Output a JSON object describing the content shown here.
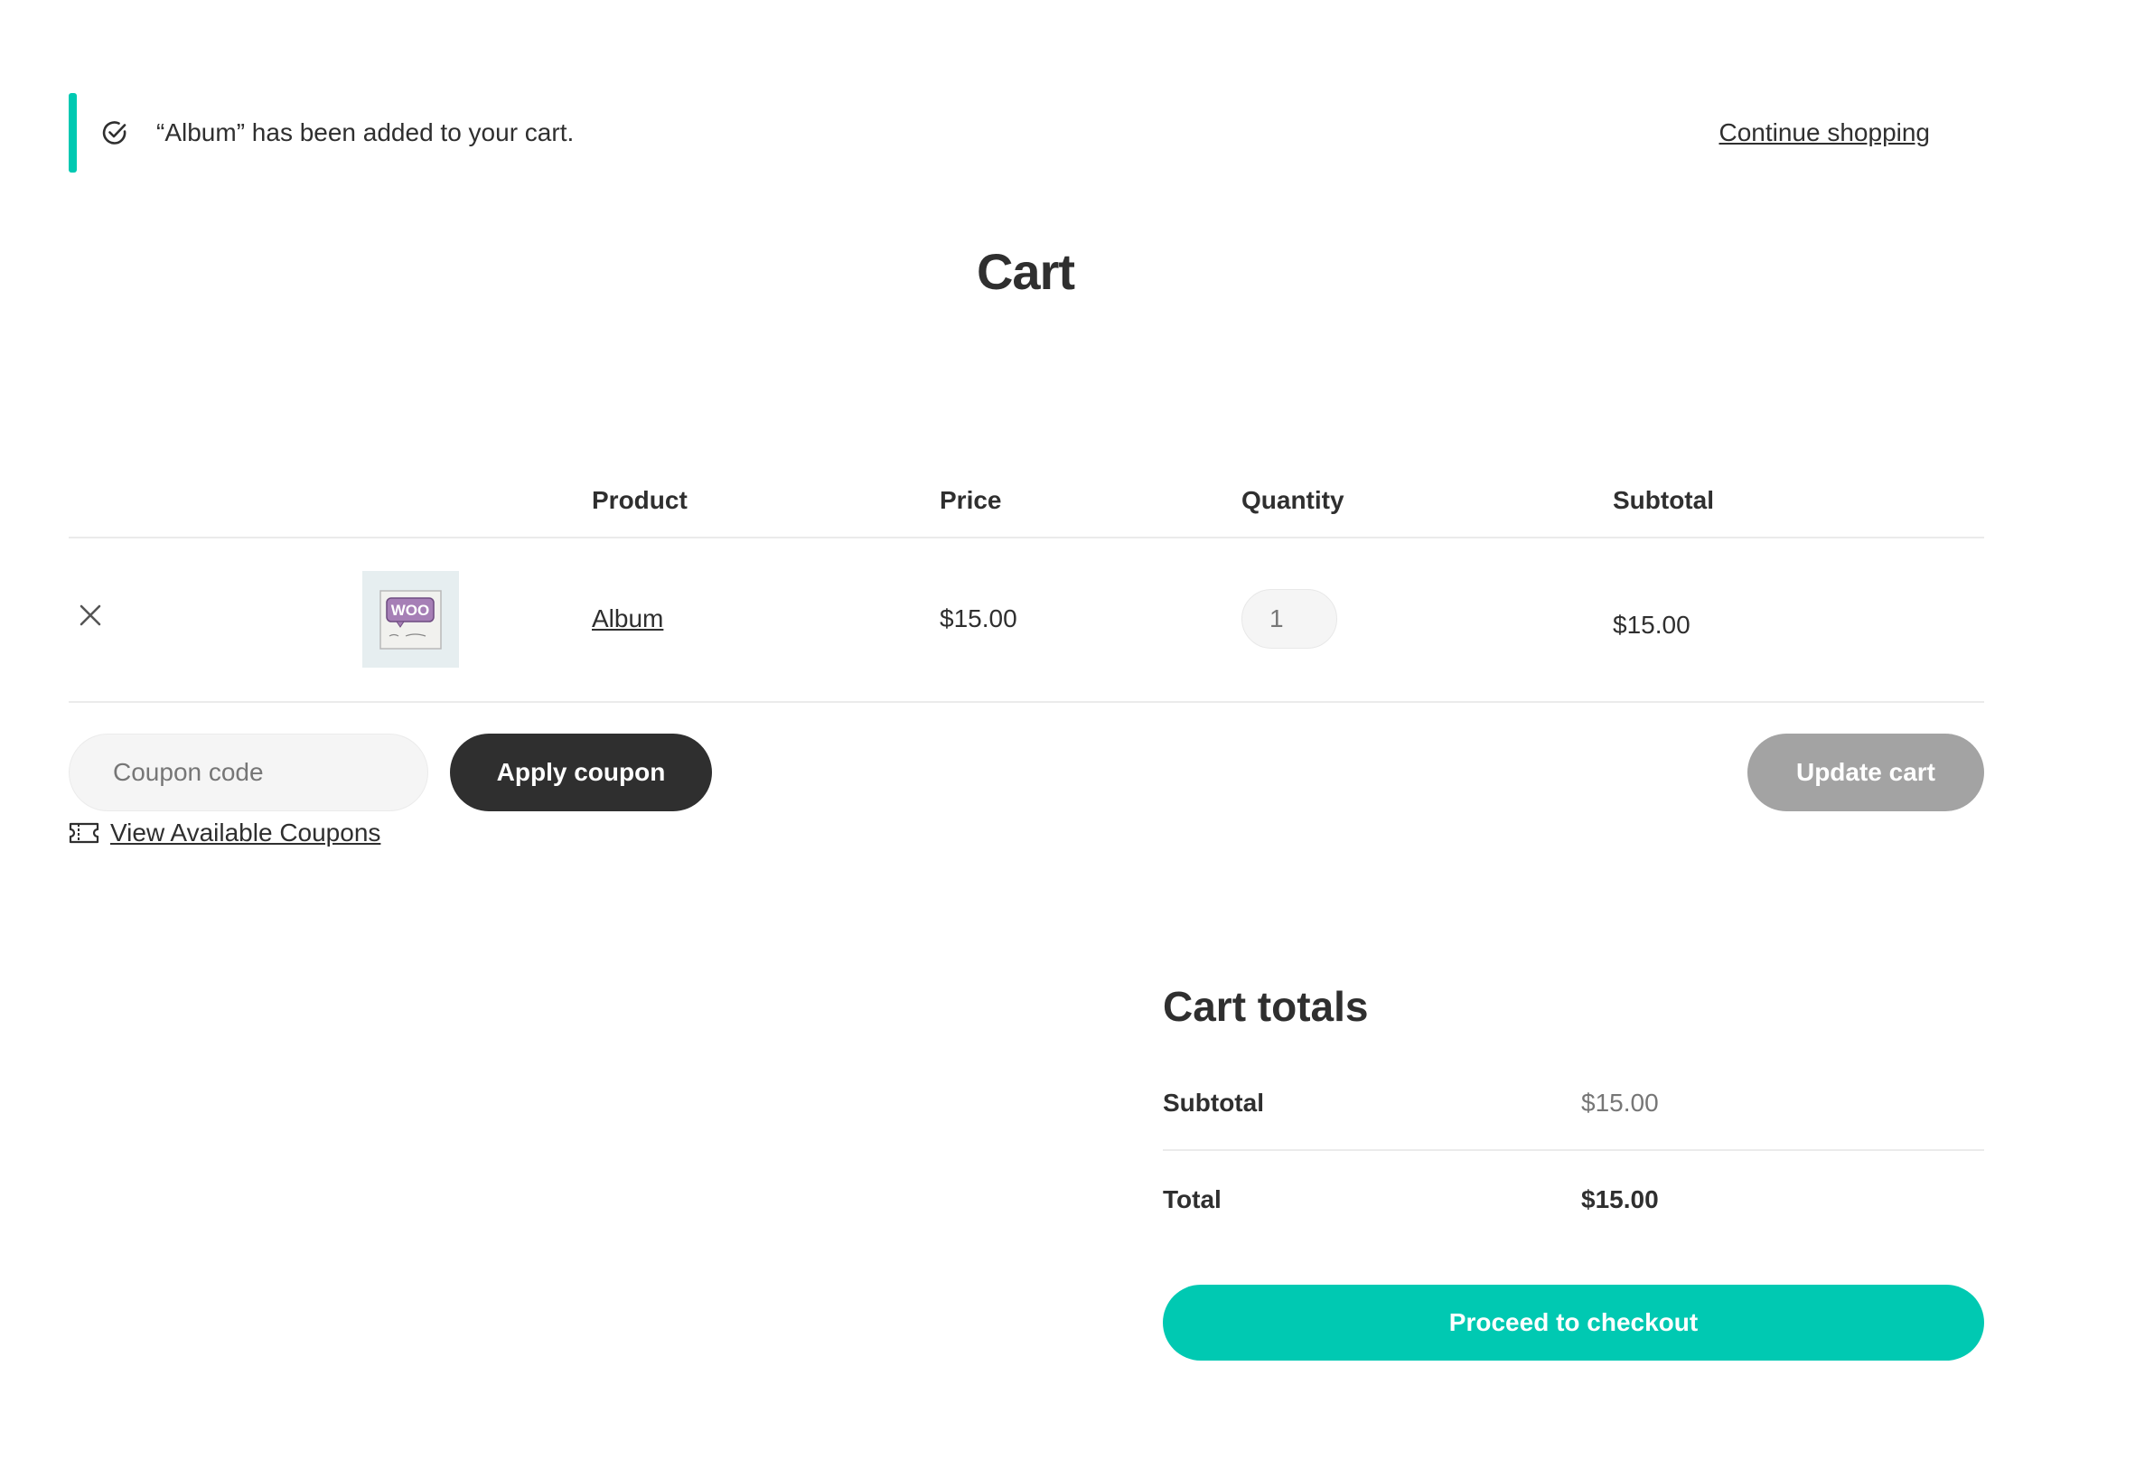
{
  "notice": {
    "message": "“Album” has been added to your cart.",
    "continue_label": "Continue shopping",
    "accent_color": "#00c9b2",
    "icon": "check-circle-icon"
  },
  "page": {
    "title": "Cart"
  },
  "cart": {
    "headers": {
      "product": "Product",
      "price": "Price",
      "quantity": "Quantity",
      "subtotal": "Subtotal"
    },
    "items": [
      {
        "remove_icon": "close-icon",
        "name": "Album",
        "thumbnail_text": "WOO",
        "price": "$15.00",
        "quantity": "1",
        "subtotal": "$15.00"
      }
    ]
  },
  "coupon": {
    "placeholder": "Coupon code",
    "apply_label": "Apply coupon",
    "view_label": "View Available Coupons",
    "view_icon": "ticket-icon"
  },
  "update_label": "Update cart",
  "totals": {
    "title": "Cart totals",
    "subtotal_label": "Subtotal",
    "subtotal_value": "$15.00",
    "total_label": "Total",
    "total_value": "$15.00"
  },
  "checkout_label": "Proceed to checkout",
  "colors": {
    "accent": "#00c9b2",
    "dark": "#2f2f2f",
    "muted_button": "#a3a3a3"
  }
}
